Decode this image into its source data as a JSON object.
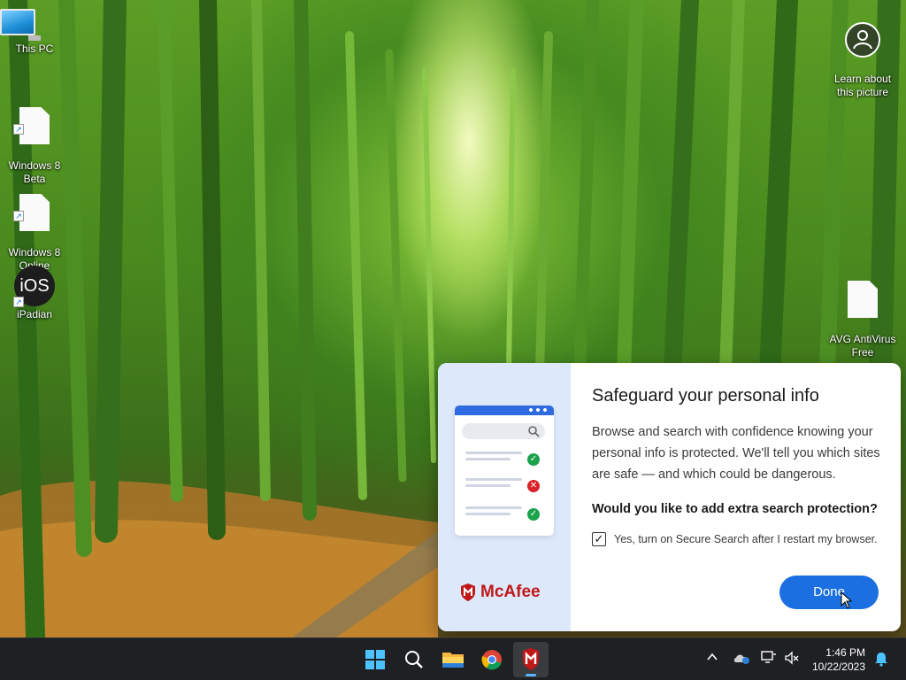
{
  "desktop": {
    "icons": [
      {
        "label": "This PC",
        "icon": "this-pc-icon"
      },
      {
        "label": "Windows 8\nBeta",
        "icon": "file-shortcut-icon"
      },
      {
        "label": "Windows 8\nOnline",
        "icon": "file-shortcut-icon"
      },
      {
        "label": "iPadian",
        "icon": "ios-icon",
        "glyph_text": "iOS"
      },
      {
        "label": "Learn about\nthis picture",
        "icon": "camera-learn-icon"
      },
      {
        "label": "AVG AntiVirus\nFree",
        "icon": "file-shortcut-icon"
      }
    ]
  },
  "popup": {
    "brand": "McAfee",
    "title": "Safeguard your personal info",
    "body": "Browse and search with confidence knowing your personal info is protected. We'll tell you which sites are safe — and which could be dangerous.",
    "question": "Would you like to add extra search protection?",
    "checkbox_label": "Yes, turn on Secure Search after I restart my browser.",
    "checkbox_checked": true,
    "done_label": "Done",
    "accent": "#1b6fe0",
    "brand_color": "#c01818"
  },
  "taskbar": {
    "apps": [
      {
        "name": "start",
        "icon": "windows-start-icon"
      },
      {
        "name": "search",
        "icon": "search-icon"
      },
      {
        "name": "file-explorer",
        "icon": "folder-icon"
      },
      {
        "name": "chrome",
        "icon": "chrome-icon"
      },
      {
        "name": "mcafee",
        "icon": "mcafee-icon",
        "active": true
      }
    ],
    "tray": {
      "chevron": "chevron-up-icon",
      "time": "1:46 PM",
      "date": "10/22/2023"
    }
  }
}
